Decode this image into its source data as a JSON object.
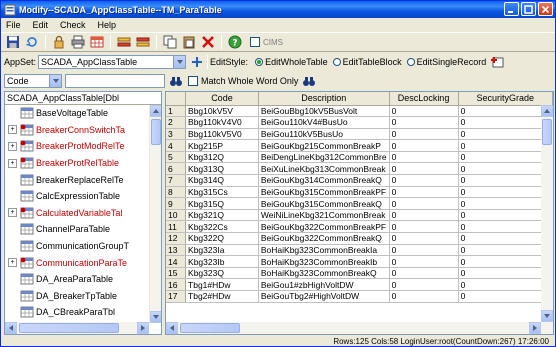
{
  "window": {
    "title": "Modify--SCADA_AppClassTable--TM_ParaTable"
  },
  "menu": [
    "File",
    "Edit",
    "Check",
    "Help"
  ],
  "toolbar": {
    "cims_label": "CIMS"
  },
  "appset": {
    "label": "AppSet:",
    "value": "SCADA_AppClassTable",
    "editstyle_label": "EditStyle:",
    "options": [
      {
        "label": "EditWholeTable",
        "selected": true
      },
      {
        "label": "EditTableBlock",
        "selected": false
      },
      {
        "label": "EditSingleRecord",
        "selected": false
      }
    ]
  },
  "search": {
    "field_value": "Code",
    "match_whole_label": "Match Whole Word Only"
  },
  "tree": {
    "header": "SCADA_AppClassTable[Dbl",
    "items": [
      {
        "label": "BaseVoltageTable",
        "red": false,
        "expander": false
      },
      {
        "label": "BreakerConnSwitchTa",
        "red": true,
        "expander": true
      },
      {
        "label": "BreakerProtModRelTe",
        "red": true,
        "expander": true
      },
      {
        "label": "BreakerProtRelTable",
        "red": true,
        "expander": true
      },
      {
        "label": "BreakerReplaceRelTe",
        "red": false,
        "expander": false
      },
      {
        "label": "CalcExpressionTable",
        "red": false,
        "expander": false
      },
      {
        "label": "CalculatedVariableTal",
        "red": true,
        "expander": true
      },
      {
        "label": "ChannelParaTable",
        "red": false,
        "expander": false
      },
      {
        "label": "CommunicationGroupT",
        "red": false,
        "expander": false
      },
      {
        "label": "CommunicationParaTe",
        "red": true,
        "expander": true
      },
      {
        "label": "DA_AreaParaTable",
        "red": false,
        "expander": false
      },
      {
        "label": "DA_BreakerTpTable",
        "red": false,
        "expander": false
      },
      {
        "label": "DA_CBreakParaTbl",
        "red": false,
        "expander": false
      },
      {
        "label": "DA_LineTpTable",
        "red": false,
        "expander": false
      }
    ]
  },
  "grid": {
    "columns": [
      "",
      "Code",
      "Description",
      "DescLocking",
      "SecurityGrade"
    ],
    "rows": [
      [
        "1",
        "Bbg10kV5V",
        "BeiGouBbg10kV5BusVolt",
        "0",
        "0"
      ],
      [
        "2",
        "Bbg110kV4V0",
        "BeiGou110kV4#BusUo",
        "0",
        "0"
      ],
      [
        "3",
        "Bbg110kV5V0",
        "BeiGou110kV5BusUo",
        "0",
        "0"
      ],
      [
        "4",
        "Kbg215P",
        "BeiGouKbg215CommonBreakP",
        "0",
        "0"
      ],
      [
        "5",
        "Kbg312Q",
        "BeiDengLineKbg312CommonBre",
        "0",
        "0"
      ],
      [
        "6",
        "Kbg313Q",
        "BeiXuLineKbg313CommonBreak",
        "0",
        "0"
      ],
      [
        "7",
        "Kbg314Q",
        "BeiGouKbg314CommonBreakQ",
        "0",
        "0"
      ],
      [
        "8",
        "Kbg315Cs",
        "BeiGouKbg315CommonBreakPF",
        "0",
        "0"
      ],
      [
        "9",
        "Kbg315Q",
        "BeiGouKbg315CommonBreakQ",
        "0",
        "0"
      ],
      [
        "10",
        "Kbg321Q",
        "WeiNiLineKbg321CommonBreak",
        "0",
        "0"
      ],
      [
        "11",
        "Kbg322Cs",
        "BeiGouKbg322CommonBreakPF",
        "0",
        "0"
      ],
      [
        "12",
        "Kbg322Q",
        "BeiGouKbg322CommonBreakQ",
        "0",
        "0"
      ],
      [
        "13",
        "Kbg323Ia",
        "BoHaiKbg323CommonBreakIa",
        "0",
        "0"
      ],
      [
        "14",
        "Kbg323Ib",
        "BoHaiKbg323CommonBreakIb",
        "0",
        "0"
      ],
      [
        "15",
        "Kbg323Q",
        "BoHaiKbg323CommonBreakQ",
        "0",
        "0"
      ],
      [
        "16",
        "Tbg1#HDw",
        "BeiGou1#zbHighVoltDW",
        "0",
        "0"
      ],
      [
        "17",
        "Tbg2#HDw",
        "BeiGouTbg2#HighVoltDW",
        "0",
        "0"
      ]
    ]
  },
  "status": {
    "text": "Rows:125 Cols:58 LoginUser:root(CountDown:267) 17:26:00"
  },
  "colors": {
    "title_bar": "#0a56e3",
    "red_item": "#c00000"
  }
}
